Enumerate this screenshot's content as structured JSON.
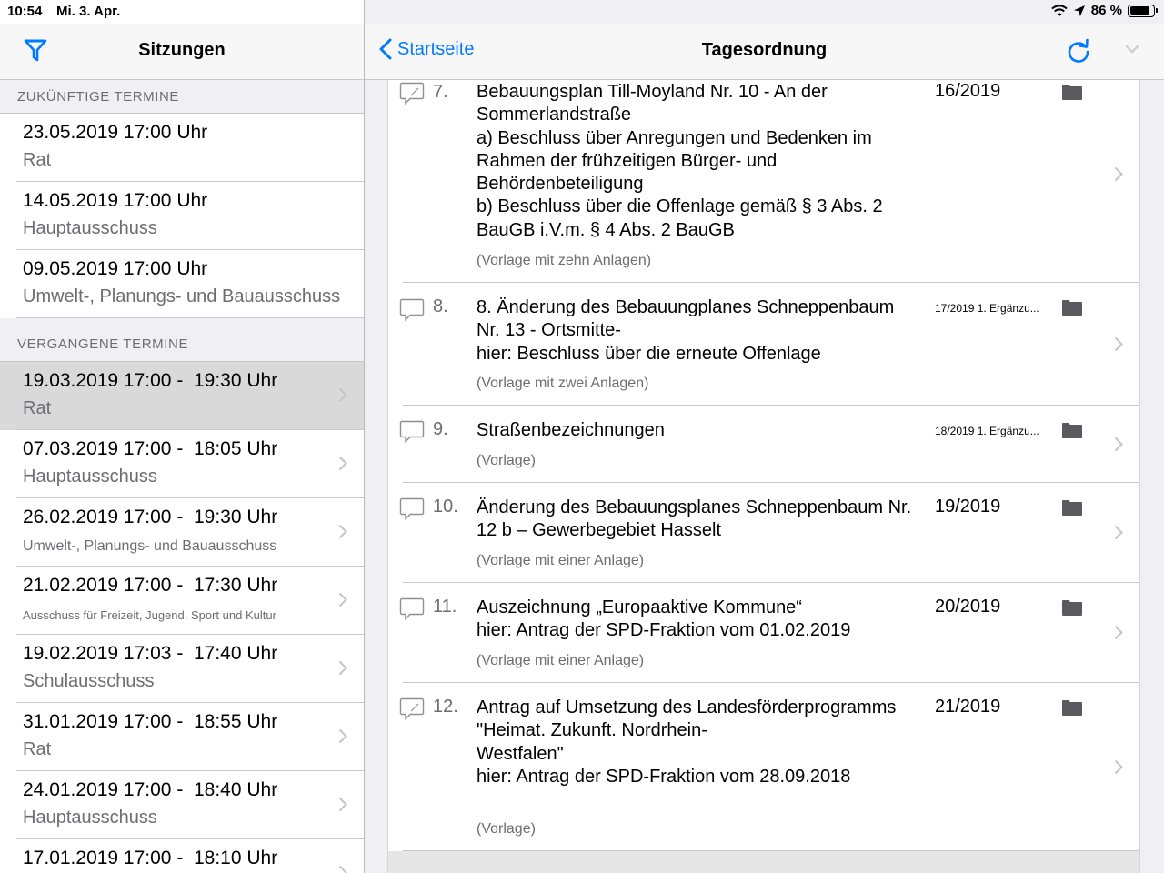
{
  "status_bar": {
    "time": "10:54",
    "date": "Mi. 3. Apr.",
    "battery": "86 %",
    "battery_level": 0.86
  },
  "master": {
    "title": "Sitzungen",
    "upcoming_header": "ZUKÜNFTIGE TERMINE",
    "upcoming": [
      {
        "datetime": "23.05.2019 17:00 Uhr",
        "body": "Rat"
      },
      {
        "datetime": "14.05.2019 17:00 Uhr",
        "body": "Hauptausschuss"
      },
      {
        "datetime": "09.05.2019 17:00 Uhr",
        "body": "Umwelt-, Planungs- und Bauausschuss"
      }
    ],
    "past_header": "VERGANGENE TERMINE",
    "past": [
      {
        "datetime": "19.03.2019 17:00 -  19:30 Uhr",
        "body": "Rat"
      },
      {
        "datetime": "07.03.2019 17:00 -  18:05 Uhr",
        "body": "Hauptausschuss"
      },
      {
        "datetime": "26.02.2019 17:00 -  19:30 Uhr",
        "body": "Umwelt-, Planungs- und Bauausschuss"
      },
      {
        "datetime": "21.02.2019 17:00 -  17:30 Uhr",
        "body": "Ausschuss für Freizeit, Jugend, Sport und Kultur"
      },
      {
        "datetime": "19.02.2019 17:03 -  17:40 Uhr",
        "body": "Schulausschuss"
      },
      {
        "datetime": "31.01.2019 17:00 -  18:55 Uhr",
        "body": "Rat"
      },
      {
        "datetime": "24.01.2019 17:00 -  18:40 Uhr",
        "body": "Hauptausschuss"
      },
      {
        "datetime": "17.01.2019 17:00 -  18:10 Uhr",
        "body": ""
      }
    ]
  },
  "detail": {
    "back_label": "Startseite",
    "title": "Tagesordnung",
    "items": [
      {
        "number": "7.",
        "title": "Bebauungsplan Till-Moyland Nr. 10 - An der Sommerlandstraße\na) Beschluss über Anregungen und Bedenken im Rahmen der frühzeitigen Bürger- und Behördenbeteiligung\nb) Beschluss über die Offenlage gemäß § 3 Abs. 2 BauGB i.V.m. § 4 Abs. 2 BauGB",
        "note": "(Vorlage mit zehn Anlagen)",
        "reference": "16/2019"
      },
      {
        "number": "8.",
        "title": "8. Änderung des Bebauungplanes Schneppenbaum Nr. 13 - Ortsmitte-\nhier: Beschluss über die erneute Offenlage",
        "note": "(Vorlage mit zwei Anlagen)",
        "reference": "17/2019 1. Ergänzu..."
      },
      {
        "number": "9.",
        "title": "Straßenbezeichnungen",
        "note": "(Vorlage)",
        "reference": "18/2019 1. Ergänzu..."
      },
      {
        "number": "10.",
        "title": "Änderung des Bebauungsplanes Schneppenbaum Nr. 12 b – Gewerbegebiet Hasselt",
        "note": "(Vorlage mit einer Anlage)",
        "reference": "19/2019"
      },
      {
        "number": "11.",
        "title": "Auszeichnung „Europaaktive Kommune“\nhier: Antrag der SPD-Fraktion vom 01.02.2019",
        "note": "(Vorlage mit einer Anlage)",
        "reference": "20/2019"
      },
      {
        "number": "12.",
        "title": "Antrag auf Umsetzung des Landesförderprogramms \"Heimat. Zukunft. Nordrhein-\nWestfalen\"\nhier: Antrag der SPD-Fraktion vom 28.09.2018",
        "note": "(Vorlage)",
        "reference": "21/2019"
      }
    ]
  },
  "colors": {
    "accent": "#007aff",
    "selected_row": "#d9d9d9",
    "section_bg": "#efeff4"
  }
}
